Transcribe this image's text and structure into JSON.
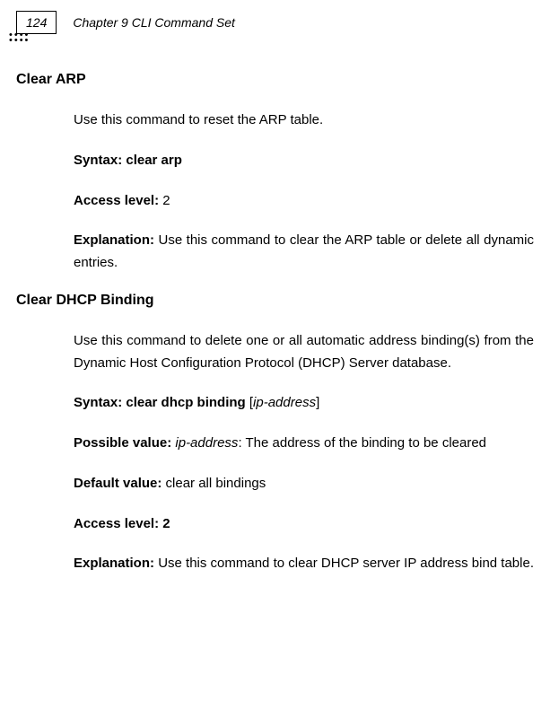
{
  "header": {
    "pageNumber": "124",
    "chapterTitle": "Chapter 9 CLI Command Set"
  },
  "sections": {
    "clearArp": {
      "title": "Clear ARP",
      "intro": "Use this command to reset the ARP table.",
      "syntaxLabel": "Syntax: clear arp",
      "accessLevelLabel": "Access level: ",
      "accessLevelValue": "2",
      "explanationLabel": "Explanation: ",
      "explanationText": "Use this command to clear the ARP table or delete all dynamic entries."
    },
    "clearDhcp": {
      "title": "Clear DHCP Binding",
      "intro": "Use this command to delete one or all automatic address binding(s) from the Dynamic Host Configuration Protocol (DHCP) Server database.",
      "syntaxLabelPrefix": "Syntax:  clear dhcp binding ",
      "syntaxBracketOpen": "[",
      "syntaxParam": "ip-address",
      "syntaxBracketClose": "]",
      "possibleValueLabel": "Possible value: ",
      "possibleValueParam": "ip-address",
      "possibleValueText": ": The address of the binding to be cleared",
      "defaultValueLabel": "Default value: ",
      "defaultValueText": "clear all bindings",
      "accessLevelLabel": "Access level: 2",
      "explanationLabel": "Explanation: ",
      "explanationText": "Use this command to clear DHCP server IP address bind table."
    }
  }
}
